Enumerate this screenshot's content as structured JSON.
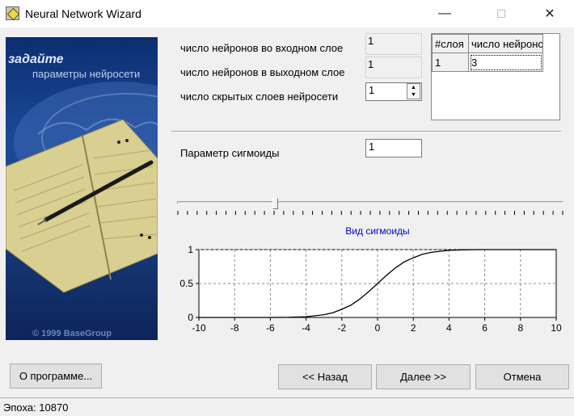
{
  "window": {
    "title": "Neural Network Wizard",
    "minimize_glyph": "—",
    "close_glyph": "✕"
  },
  "picture": {
    "heading": "задайте",
    "subheading": "параметры нейросети",
    "copyright": "© 1999 BaseGroup"
  },
  "params": {
    "input_neurons_label": "число нейронов во входном слое",
    "input_neurons_value": "1",
    "output_neurons_label": "число нейронов в выходном слое",
    "output_neurons_value": "1",
    "hidden_layers_label": "число скрытых слоев нейросети",
    "hidden_layers_value": "1",
    "sigmoid_label": "Параметр сигмоиды",
    "sigmoid_value": "1"
  },
  "layers_grid": {
    "columns": [
      "#слоя",
      "число нейроно"
    ],
    "rows": [
      [
        "1",
        "3"
      ]
    ]
  },
  "slider": {
    "value_fraction": 0.25
  },
  "chart_data": {
    "type": "line",
    "title": "Вид сигмоиды",
    "xlim": [
      -10,
      10
    ],
    "ylim": [
      0,
      1
    ],
    "x_ticks": [
      -10,
      -8,
      -6,
      -4,
      -2,
      0,
      2,
      4,
      6,
      8,
      10
    ],
    "y_ticks": [
      0,
      0.5,
      1
    ],
    "grid": true,
    "series": [
      {
        "x": [
          -10,
          -8,
          -6,
          -5,
          -4,
          -3,
          -2.5,
          -2,
          -1.5,
          -1,
          -0.5,
          0,
          0.5,
          1,
          1.5,
          2,
          2.5,
          3,
          4,
          5,
          6,
          8,
          10
        ],
        "values": [
          0,
          0,
          0,
          0.002,
          0.01,
          0.04,
          0.07,
          0.12,
          0.18,
          0.27,
          0.38,
          0.5,
          0.62,
          0.73,
          0.82,
          0.88,
          0.93,
          0.96,
          0.99,
          0.998,
          1,
          1,
          1
        ]
      }
    ],
    "line_color": "#000000",
    "title_color": "#0000cc"
  },
  "buttons": {
    "about": "О программе...",
    "back": "<< Назад",
    "next": "Далее >>",
    "cancel": "Отмена"
  },
  "status": {
    "text": "Эпоха: 10870"
  }
}
